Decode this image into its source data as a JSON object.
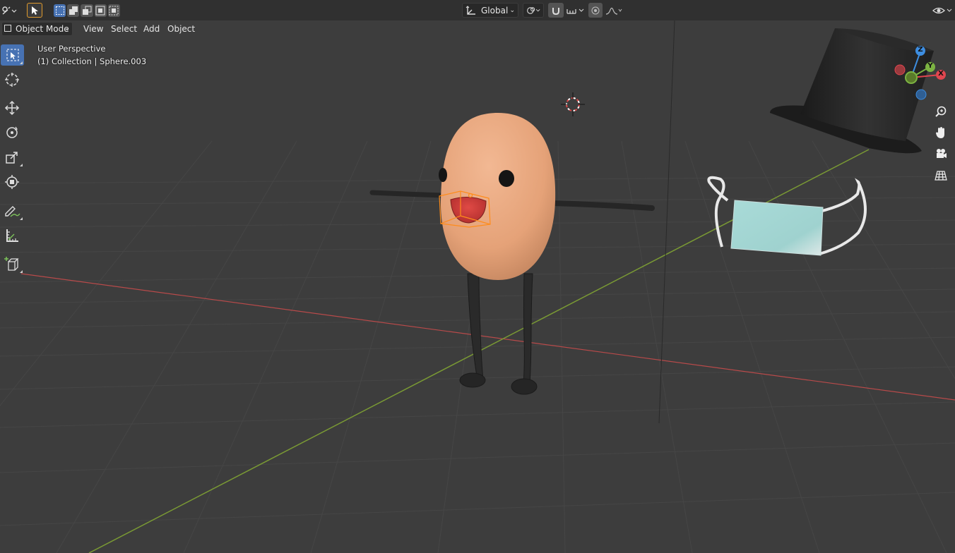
{
  "header": {
    "transform_orientation": "Global"
  },
  "menubar": {
    "mode": "Object Mode",
    "items": [
      "View",
      "Select",
      "Add",
      "Object"
    ]
  },
  "overlay": {
    "view_name": "User Perspective",
    "collection_info": "(1) Collection | Sphere.003"
  },
  "toolbar": {
    "tools": [
      "select-box",
      "cursor",
      "move",
      "rotate",
      "scale",
      "transform",
      "annotate",
      "measure",
      "add-cube"
    ],
    "active": "select-box"
  },
  "gizmo": {
    "axes": [
      "Z",
      "Y",
      "X"
    ]
  },
  "colors": {
    "accent": "#4772b3",
    "x_axis": "#e0464f",
    "y_axis": "#7cb342",
    "z_axis": "#3d8de0",
    "selection": "#ff8c1a"
  }
}
